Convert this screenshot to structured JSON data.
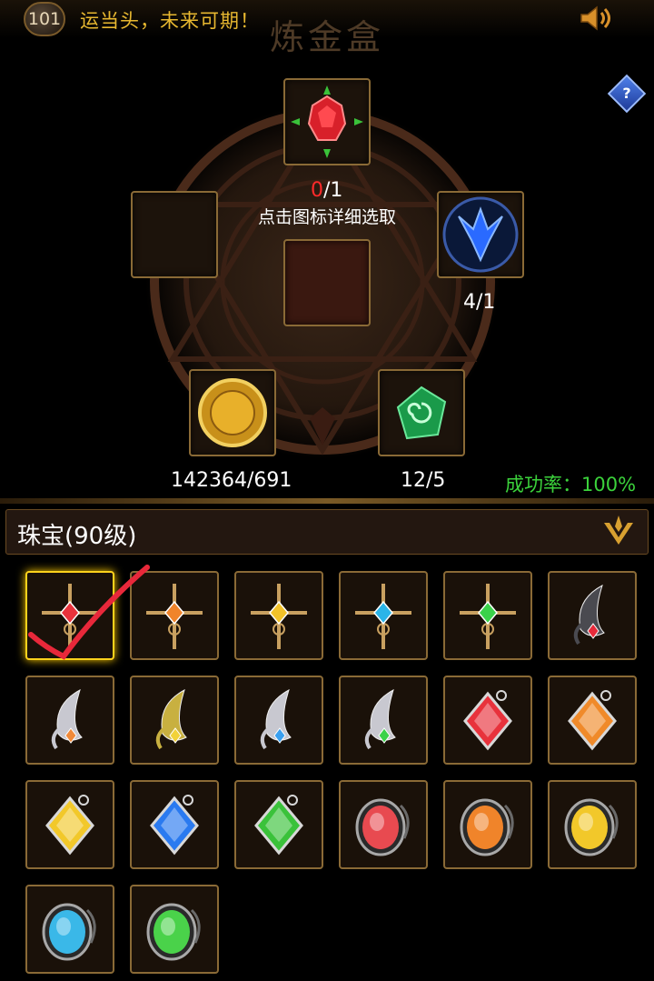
{
  "header": {
    "level": "101",
    "marquee": "运当头，未来可期！",
    "title": "炼金盒",
    "help_label": "?"
  },
  "alchemy": {
    "top_slot": {
      "icon": "red-gem-icon",
      "count_have": "0",
      "count_need": "/1",
      "hint": "点击图标详细选取"
    },
    "right_slot": {
      "icon": "blue-crystal-icon",
      "count": "4/1"
    },
    "gold": {
      "icon": "gold-coin-icon",
      "count": "142364/691"
    },
    "essence": {
      "icon": "green-spiral-icon",
      "count": "12/5"
    },
    "success_rate": "成功率：100%"
  },
  "category": {
    "label": "珠宝(90级)"
  },
  "items": [
    {
      "type": "cross",
      "color": "#e8323c"
    },
    {
      "type": "cross",
      "color": "#f0842a"
    },
    {
      "type": "cross",
      "color": "#f2c22a"
    },
    {
      "type": "cross",
      "color": "#2ab4e8"
    },
    {
      "type": "cross",
      "color": "#3ad24a"
    },
    {
      "type": "wing-dark",
      "color": "#e82a3a"
    },
    {
      "type": "wing",
      "color": "#f08a3a"
    },
    {
      "type": "wing-gold",
      "color": "#f2d23a"
    },
    {
      "type": "wing",
      "color": "#3aa0f0"
    },
    {
      "type": "wing",
      "color": "#3ad24a"
    },
    {
      "type": "diamond",
      "color": "#e8323c"
    },
    {
      "type": "diamond",
      "color": "#f08a2a"
    },
    {
      "type": "diamond",
      "color": "#f2c82a"
    },
    {
      "type": "diamond",
      "color": "#2a7af0"
    },
    {
      "type": "diamond",
      "color": "#3ac23a"
    },
    {
      "type": "oval",
      "color": "#e84a50"
    },
    {
      "type": "oval",
      "color": "#f0842a"
    },
    {
      "type": "oval",
      "color": "#f2c82a"
    },
    {
      "type": "oval",
      "color": "#3ab8e8"
    },
    {
      "type": "oval",
      "color": "#4ad24a"
    }
  ],
  "colors": {
    "accent": "#e8b830",
    "success": "#3bd23b",
    "warning": "#ff2a2a"
  }
}
